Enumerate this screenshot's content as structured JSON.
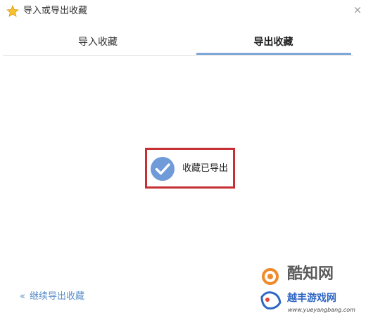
{
  "window": {
    "title": "导入或导出收藏",
    "close_glyph": "×"
  },
  "tabs": [
    {
      "label": "导入收藏",
      "active": false
    },
    {
      "label": "导出收藏",
      "active": true
    }
  ],
  "status": {
    "message": "收藏已导出",
    "icon": "check-circle-icon"
  },
  "footer": {
    "chevron": "«",
    "continue_label": "继续导出收藏"
  },
  "watermark": {
    "line1": "酷知网",
    "line2": "越丰游戏网",
    "url": "www.yueyangbang.com"
  },
  "colors": {
    "accent": "#7ea6d6",
    "check_circle": "#6f9bd9",
    "highlight_border": "#c62f34",
    "link": "#5d8fca"
  }
}
